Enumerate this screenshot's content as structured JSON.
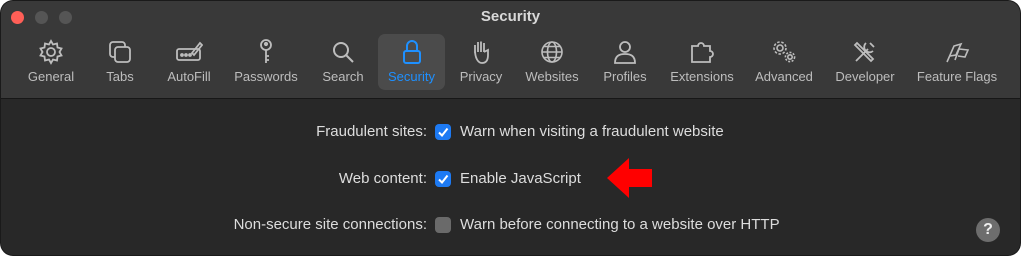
{
  "window": {
    "title": "Security"
  },
  "toolbar": {
    "tabs": [
      {
        "label": "General",
        "icon": "gear-icon"
      },
      {
        "label": "Tabs",
        "icon": "tabs-icon"
      },
      {
        "label": "AutoFill",
        "icon": "autofill-icon"
      },
      {
        "label": "Passwords",
        "icon": "key-icon"
      },
      {
        "label": "Search",
        "icon": "search-icon"
      },
      {
        "label": "Security",
        "icon": "lock-icon",
        "selected": true
      },
      {
        "label": "Privacy",
        "icon": "hand-icon"
      },
      {
        "label": "Websites",
        "icon": "globe-icon"
      },
      {
        "label": "Profiles",
        "icon": "person-icon"
      },
      {
        "label": "Extensions",
        "icon": "puzzle-icon"
      },
      {
        "label": "Advanced",
        "icon": "gears-icon"
      },
      {
        "label": "Developer",
        "icon": "tools-icon"
      },
      {
        "label": "Feature Flags",
        "icon": "flags-icon"
      }
    ]
  },
  "settings": {
    "fraudulent": {
      "label": "Fraudulent sites:",
      "option": "Warn when visiting a fraudulent website",
      "checked": true
    },
    "web_content": {
      "label": "Web content:",
      "option": "Enable JavaScript",
      "checked": true
    },
    "non_secure": {
      "label": "Non-secure site connections:",
      "option": "Warn before connecting to a website over HTTP",
      "checked": false
    }
  },
  "help": {
    "label": "?"
  },
  "colors": {
    "accent": "#1d7af3",
    "selected_label": "#1e90ff",
    "annotation_arrow": "#ff0000",
    "close_button": "#ff5f57"
  }
}
